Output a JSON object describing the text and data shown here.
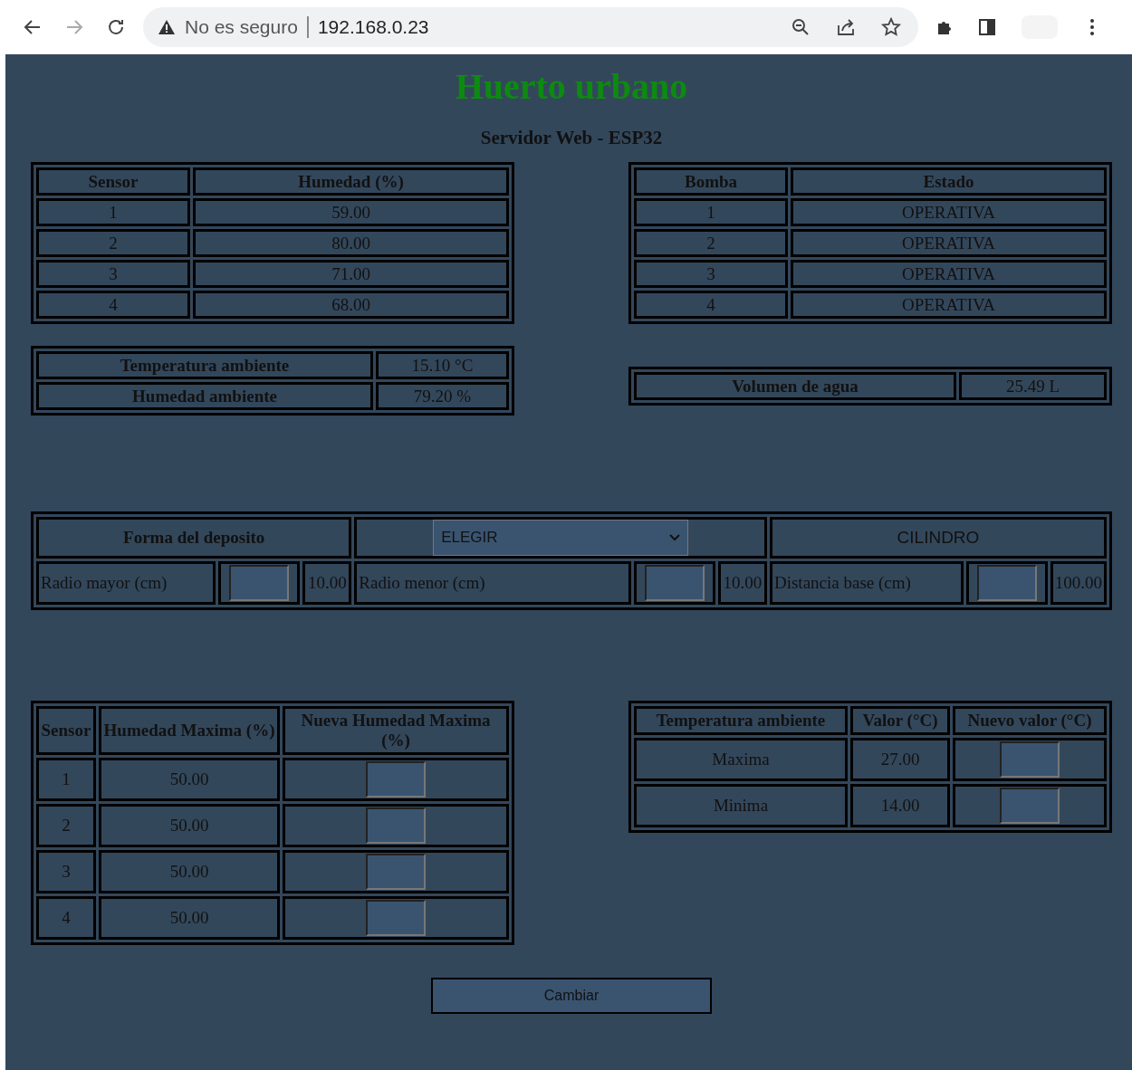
{
  "browser": {
    "security": "No es seguro",
    "url": "192.168.0.23"
  },
  "page": {
    "title": "Huerto urbano",
    "subtitle": "Servidor Web - ESP32"
  },
  "humidity_table": {
    "columns": [
      "Sensor",
      "Humedad (%)"
    ],
    "rows": [
      [
        "1",
        "59.00"
      ],
      [
        "2",
        "80.00"
      ],
      [
        "3",
        "71.00"
      ],
      [
        "4",
        "68.00"
      ]
    ]
  },
  "pump_table": {
    "columns": [
      "Bomba",
      "Estado"
    ],
    "rows": [
      [
        "1",
        "OPERATIVA"
      ],
      [
        "2",
        "OPERATIVA"
      ],
      [
        "3",
        "OPERATIVA"
      ],
      [
        "4",
        "OPERATIVA"
      ]
    ]
  },
  "ambient_table": {
    "rows": [
      [
        "Temperatura ambiente",
        "15.10 °C"
      ],
      [
        "Humedad ambiente",
        "79.20 %"
      ]
    ]
  },
  "water_table": {
    "rows": [
      [
        "Volumen de agua",
        "25.49 L"
      ]
    ]
  },
  "tank_table": {
    "heading": "Forma del deposito",
    "select": {
      "value": "ELEGIR"
    },
    "shape": "CILINDRO",
    "params": [
      {
        "label": "Radio mayor (cm)",
        "value": "10.00"
      },
      {
        "label": "Radio menor (cm)",
        "value": "10.00"
      },
      {
        "label": "Distancia base (cm)",
        "value": "100.00"
      }
    ]
  },
  "max_humidity_table": {
    "columns": [
      "Sensor",
      "Humedad Maxima (%)",
      "Nueva Humedad Maxima (%)"
    ],
    "rows": [
      [
        "1",
        "50.00"
      ],
      [
        "2",
        "50.00"
      ],
      [
        "3",
        "50.00"
      ],
      [
        "4",
        "50.00"
      ]
    ]
  },
  "temp_limits_table": {
    "columns": [
      "Temperatura ambiente",
      "Valor (°C)",
      "Nuevo valor (°C)"
    ],
    "rows": [
      [
        "Maxima",
        "27.00"
      ],
      [
        "Minima",
        "14.00"
      ]
    ]
  },
  "submit_button": "Cambiar"
}
